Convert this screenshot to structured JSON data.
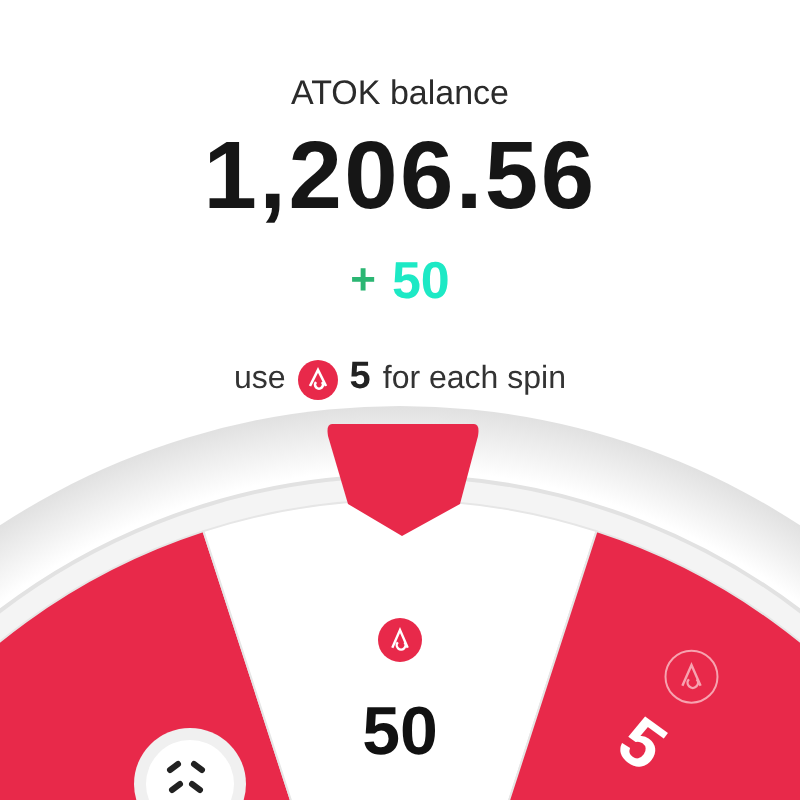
{
  "header": {
    "title": "ATOK balance",
    "balance": "1,206.56",
    "bonus_sign": "+",
    "bonus": "50"
  },
  "cost": {
    "prefix": "use",
    "amount": "5",
    "suffix": "for each spin"
  },
  "wheel": {
    "segments": [
      {
        "color": "#e8294a"
      },
      {
        "value": "50",
        "color": "#ffffff"
      },
      {
        "value": "5",
        "color": "#e8294a"
      }
    ]
  }
}
